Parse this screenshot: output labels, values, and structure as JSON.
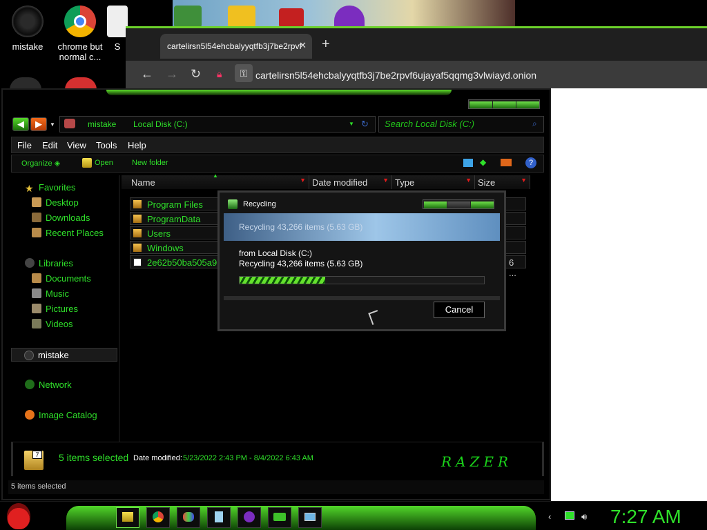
{
  "desktop": {
    "icons": [
      {
        "label": "mistake"
      },
      {
        "label": "chrome but normal c..."
      },
      {
        "label": "S"
      }
    ]
  },
  "browser": {
    "tab_title": "cartelirsn5l54ehcbalyyqtfb3j7be2rpvf",
    "url": "cartelirsn5l54ehcbalyyqtfb3j7be2rpvf6ujayaf5qqmg3vlwiayd.onion"
  },
  "explorer": {
    "breadcrumb": [
      "mistake",
      "Local Disk (C:)"
    ],
    "search_placeholder": "Search Local Disk (C:)",
    "menu": [
      "File",
      "Edit",
      "View",
      "Tools",
      "Help"
    ],
    "commands": [
      "Organize",
      "Open",
      "New folder"
    ],
    "nav": {
      "favorites": "Favorites",
      "favorites_items": [
        "Desktop",
        "Downloads",
        "Recent Places"
      ],
      "libraries": "Libraries",
      "libraries_items": [
        "Documents",
        "Music",
        "Pictures",
        "Videos"
      ],
      "computer": "mistake",
      "network": "Network",
      "catalog": "Image Catalog"
    },
    "columns": [
      "Name",
      "Date modified",
      "Type",
      "Size"
    ],
    "files": [
      {
        "name": "Program Files"
      },
      {
        "name": "ProgramData"
      },
      {
        "name": "Users"
      },
      {
        "name": "Windows"
      },
      {
        "name": "2e62b50ba505a91"
      }
    ],
    "file_size_fragment": "6 ...",
    "details": {
      "selected_big": "5 items selected",
      "date_label": "Date modified:",
      "date_value": "5/23/2022 2:43 PM - 8/4/2022 6:43 AM",
      "brand": "RAZER"
    },
    "status": "5 items selected"
  },
  "dialog": {
    "title": "Recycling",
    "banner": "Recycling 43,266 items (5.63 GB)",
    "from": "from Local Disk (C:)",
    "detail": "Recycling 43,266 items (5.63 GB)",
    "progress": 0.35,
    "cancel": "Cancel"
  },
  "taskbar": {
    "clock": "7:27 AM"
  },
  "colors": {
    "accent": "#2fe02a",
    "glow": "#52d82a",
    "danger": "#e01b1b"
  }
}
